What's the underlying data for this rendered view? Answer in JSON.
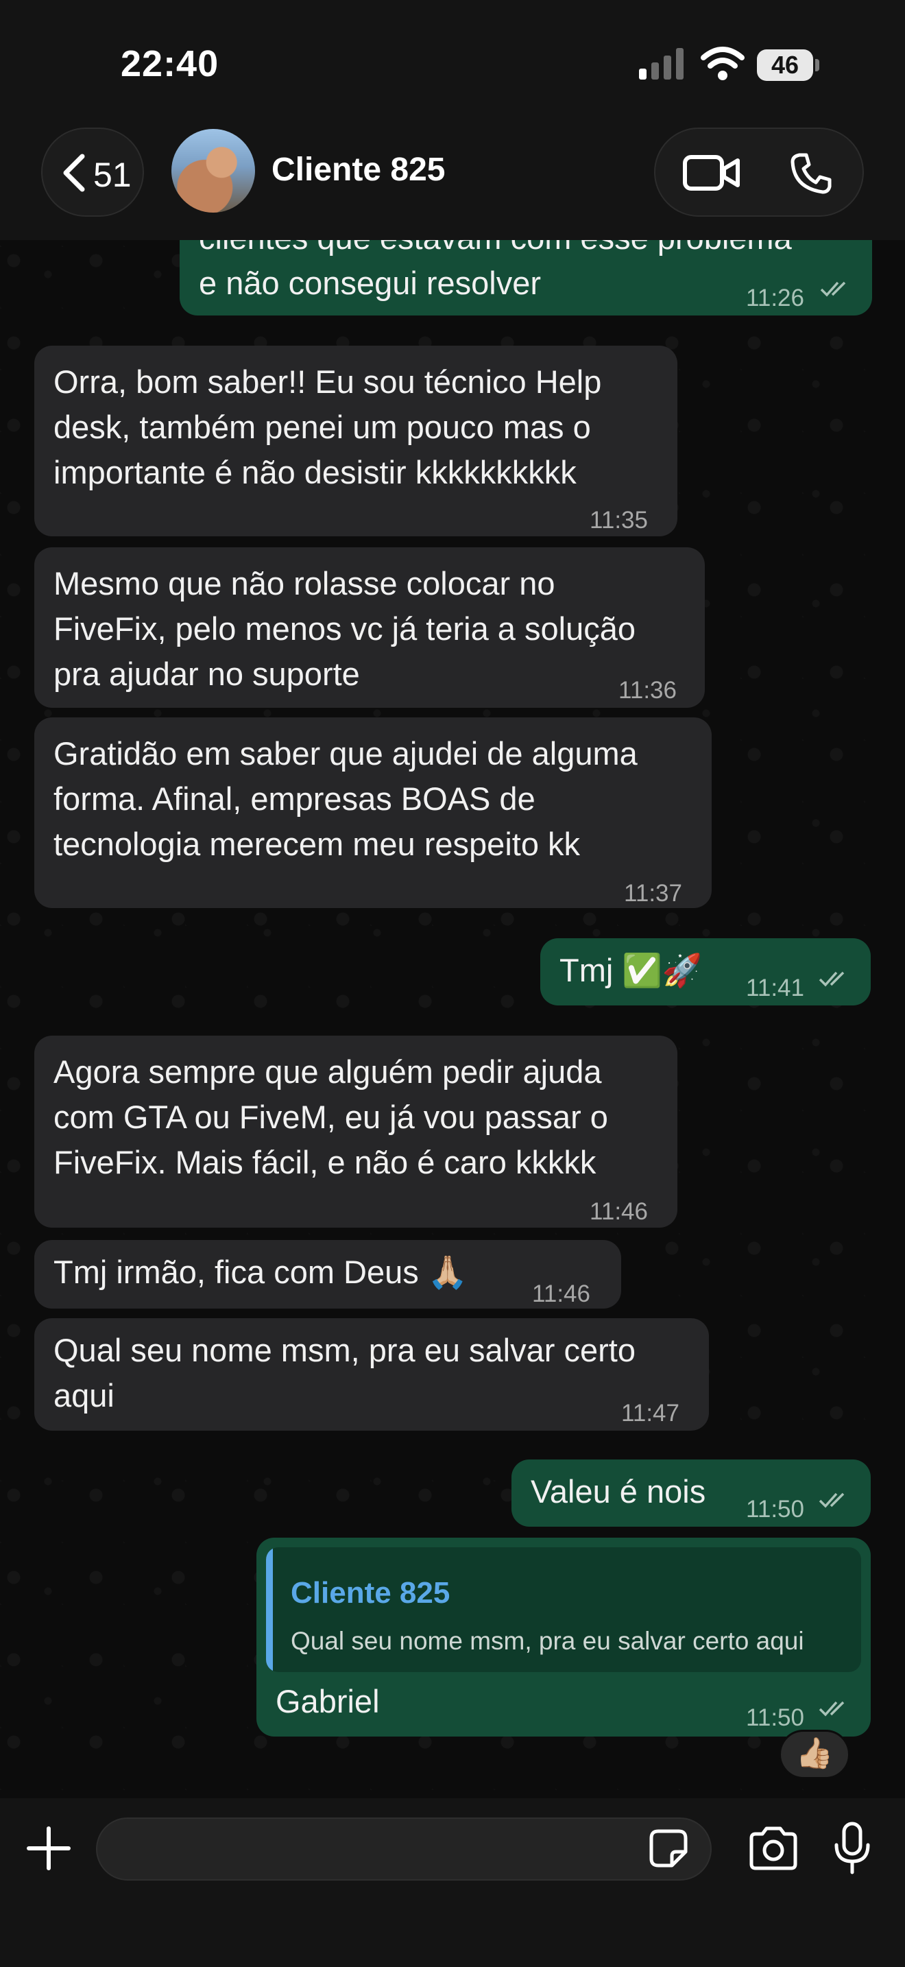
{
  "status_bar": {
    "time": "22:40",
    "battery": "46"
  },
  "header": {
    "back_count": "51",
    "contact_name": "Cliente 825"
  },
  "messages": [
    {
      "dir": "out",
      "text": "clientes que estavam com esse problema\ne não consegui resolver",
      "time": "11:26",
      "read": true
    },
    {
      "dir": "in",
      "text": "Orra, bom saber!! Eu sou técnico Help\ndesk, também penei um pouco mas o\nimportante é não desistir kkkkkkkkkk",
      "time": "11:35"
    },
    {
      "dir": "in",
      "text": "Mesmo que não rolasse colocar no\nFiveFix, pelo menos vc já teria a solução\npra ajudar no suporte",
      "time": "11:36"
    },
    {
      "dir": "in",
      "text": "Gratidão em saber que ajudei de alguma\nforma. Afinal, empresas BOAS de\ntecnologia merecem meu respeito kk",
      "time": "11:37"
    },
    {
      "dir": "out",
      "text": "Tmj ✅🚀",
      "time": "11:41",
      "read": true
    },
    {
      "dir": "in",
      "text": "Agora sempre que alguém pedir ajuda\ncom GTA ou FiveM, eu já vou passar o\nFiveFix. Mais fácil, e não é caro kkkkk",
      "time": "11:46"
    },
    {
      "dir": "in",
      "text": "Tmj irmão, fica com Deus 🙏🏼",
      "time": "11:46"
    },
    {
      "dir": "in",
      "text": "Qual seu nome msm, pra eu salvar certo\naqui",
      "time": "11:47"
    },
    {
      "dir": "out",
      "text": "Valeu é nois",
      "time": "11:50",
      "read": true
    },
    {
      "dir": "out",
      "text": "Gabriel",
      "time": "11:50",
      "read": true,
      "reply_to": {
        "name": "Cliente 825",
        "text": "Qual seu nome msm, pra eu salvar certo aqui"
      },
      "reaction": "👍🏼"
    }
  ],
  "composer": {
    "value": "",
    "placeholder": ""
  },
  "icons": {
    "back": "chevron-left-icon",
    "video": "video-call-icon",
    "phone": "voice-call-icon",
    "plus": "plus-icon",
    "sticker": "sticker-icon",
    "camera": "camera-icon",
    "mic": "microphone-icon",
    "read_receipt": "double-check-icon"
  },
  "colors": {
    "incoming_bubble": "#262628",
    "outgoing_bubble": "#144d37",
    "reply_accent": "#5aa8e8"
  }
}
